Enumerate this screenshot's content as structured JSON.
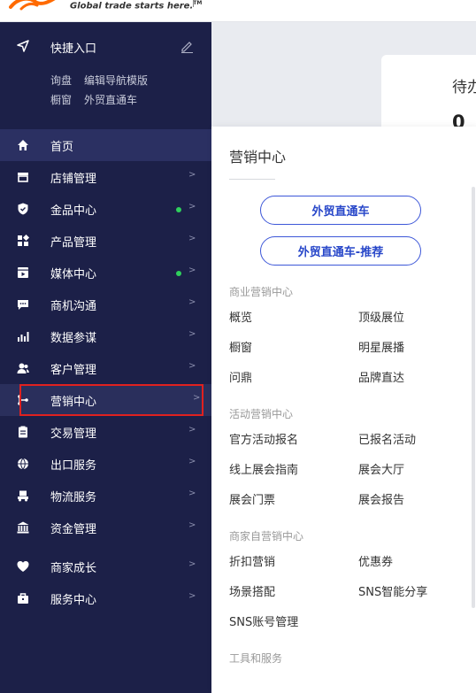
{
  "header": {
    "tagline": "Global trade starts here.",
    "trademark": "TM"
  },
  "quick_access": {
    "title": "快捷入口",
    "links": [
      "询盘",
      "编辑导航模版",
      "橱窗",
      "外贸直通车"
    ]
  },
  "sidebar": {
    "items": [
      {
        "label": "首页",
        "icon": "home-icon",
        "active": true,
        "dot": false,
        "arrow": ""
      },
      {
        "label": "店铺管理",
        "icon": "store-icon",
        "dot": false,
        "arrow": ">"
      },
      {
        "label": "金品中心",
        "icon": "shield-icon",
        "dot": true,
        "arrow": ">"
      },
      {
        "label": "产品管理",
        "icon": "product-icon",
        "dot": false,
        "arrow": ">"
      },
      {
        "label": "媒体中心",
        "icon": "media-icon",
        "dot": true,
        "arrow": ">"
      },
      {
        "label": "商机沟通",
        "icon": "chat-icon",
        "dot": false,
        "arrow": ">"
      },
      {
        "label": "数据参谋",
        "icon": "chart-icon",
        "dot": false,
        "arrow": ">"
      },
      {
        "label": "客户管理",
        "icon": "customer-icon",
        "dot": false,
        "arrow": ">"
      },
      {
        "label": "营销中心",
        "icon": "marketing-icon",
        "dot": false,
        "arrow": ">",
        "hover": true
      },
      {
        "label": "交易管理",
        "icon": "clipboard-icon",
        "dot": false,
        "arrow": ">"
      },
      {
        "label": "出口服务",
        "icon": "globe-icon",
        "dot": false,
        "arrow": ">"
      },
      {
        "label": "物流服务",
        "icon": "truck-icon",
        "dot": false,
        "arrow": ">"
      },
      {
        "label": "资金管理",
        "icon": "bank-icon",
        "dot": false,
        "arrow": ">"
      },
      {
        "label": "商家成长",
        "icon": "heart-icon",
        "dot": false,
        "arrow": ">"
      },
      {
        "label": "服务中心",
        "icon": "briefcase-icon",
        "dot": false,
        "arrow": ">"
      }
    ]
  },
  "background_card": {
    "title": "待办",
    "value": "0"
  },
  "flyout": {
    "title": "营销中心",
    "buttons": [
      "外贸直通车",
      "外贸直通车-推荐"
    ],
    "sections": [
      {
        "heading": "商业营销中心",
        "links": [
          "概览",
          "顶级展位",
          "橱窗",
          "明星展播",
          "问鼎",
          "品牌直达"
        ]
      },
      {
        "heading": "活动营销中心",
        "links": [
          "官方活动报名",
          "已报名活动",
          "线上展会指南",
          "展会大厅",
          "展会门票",
          "展会报告"
        ]
      },
      {
        "heading": "商家自营销中心",
        "links": [
          "折扣营销",
          "优惠券",
          "场景搭配",
          "SNS智能分享",
          "SNS账号管理"
        ]
      },
      {
        "heading": "工具和服务",
        "links": []
      }
    ]
  },
  "colors": {
    "sidebar_bg": "#1c2048",
    "active_item_bg": "#2b3062",
    "accent_blue": "#2847c9",
    "status_dot": "#2fd05c",
    "highlight_red": "#e0211f"
  }
}
